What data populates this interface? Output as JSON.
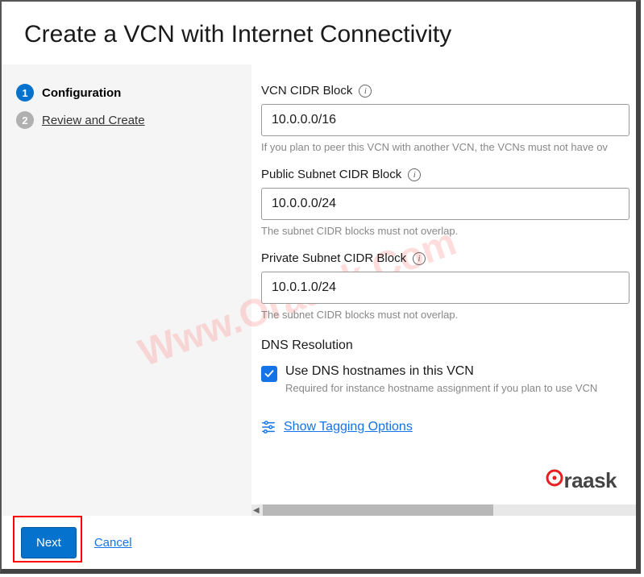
{
  "page_title": "Create a VCN with Internet Connectivity",
  "sidebar": {
    "steps": [
      {
        "num": "1",
        "label": "Configuration",
        "active": true
      },
      {
        "num": "2",
        "label": "Review and Create",
        "active": false
      }
    ]
  },
  "form": {
    "vcn_cidr": {
      "label": "VCN CIDR Block",
      "value": "10.0.0.0/16",
      "help": "If you plan to peer this VCN with another VCN, the VCNs must not have ov"
    },
    "public_subnet": {
      "label": "Public Subnet CIDR Block",
      "value": "10.0.0.0/24",
      "help": "The subnet CIDR blocks must not overlap."
    },
    "private_subnet": {
      "label": "Private Subnet CIDR Block",
      "value": "10.0.1.0/24",
      "help": "The subnet CIDR blocks must not overlap."
    },
    "dns": {
      "heading": "DNS Resolution",
      "checkbox_label": "Use DNS hostnames in this VCN",
      "checkbox_help": "Required for instance hostname assignment if you plan to use VCN",
      "checked": true
    },
    "tagging_link": "Show Tagging Options"
  },
  "footer": {
    "next": "Next",
    "cancel": "Cancel"
  },
  "branding": {
    "watermark": "Www.Oraask.Com",
    "logo_text": "raask"
  }
}
